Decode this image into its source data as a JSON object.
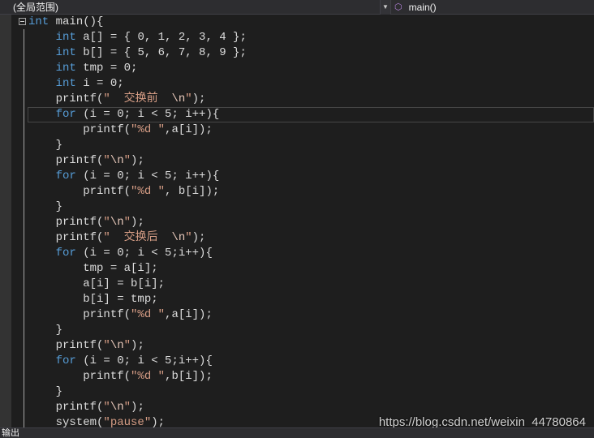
{
  "navigation_bar": {
    "scope_combo": "(全局范围)",
    "member_combo": "main()",
    "member_icon": "method-cube-icon"
  },
  "editor": {
    "lines": [
      [
        {
          "t": "int",
          "c": "kw"
        },
        {
          "t": " main(){",
          "c": "p"
        }
      ],
      [
        {
          "t": "    ",
          "c": "p"
        },
        {
          "t": "int",
          "c": "kw"
        },
        {
          "t": " a[] = { 0, 1, 2, 3, 4 };",
          "c": "p"
        }
      ],
      [
        {
          "t": "    ",
          "c": "p"
        },
        {
          "t": "int",
          "c": "kw"
        },
        {
          "t": " b[] = { 5, 6, 7, 8, 9 };",
          "c": "p"
        }
      ],
      [
        {
          "t": "    ",
          "c": "p"
        },
        {
          "t": "int",
          "c": "kw"
        },
        {
          "t": " tmp = 0;",
          "c": "p"
        }
      ],
      [
        {
          "t": "    ",
          "c": "p"
        },
        {
          "t": "int",
          "c": "kw"
        },
        {
          "t": " i = 0;",
          "c": "p"
        }
      ],
      [
        {
          "t": "    printf(",
          "c": "p"
        },
        {
          "t": "\"  交换前  ",
          "c": "str"
        },
        {
          "t": "\\n",
          "c": "esc"
        },
        {
          "t": "\"",
          "c": "str"
        },
        {
          "t": ");",
          "c": "p"
        }
      ],
      [
        {
          "t": "    ",
          "c": "p"
        },
        {
          "t": "for",
          "c": "kw"
        },
        {
          "t": " (i = 0; i < 5; i++){",
          "c": "p"
        }
      ],
      [
        {
          "t": "        printf(",
          "c": "p"
        },
        {
          "t": "\"%d \"",
          "c": "str"
        },
        {
          "t": ",a[i]);",
          "c": "p"
        }
      ],
      [
        {
          "t": "    }",
          "c": "p"
        }
      ],
      [
        {
          "t": "    printf(",
          "c": "p"
        },
        {
          "t": "\"",
          "c": "str"
        },
        {
          "t": "\\n",
          "c": "esc"
        },
        {
          "t": "\"",
          "c": "str"
        },
        {
          "t": ");",
          "c": "p"
        }
      ],
      [
        {
          "t": "    ",
          "c": "p"
        },
        {
          "t": "for",
          "c": "kw"
        },
        {
          "t": " (i = 0; i < 5; i++){",
          "c": "p"
        }
      ],
      [
        {
          "t": "        printf(",
          "c": "p"
        },
        {
          "t": "\"%d \"",
          "c": "str"
        },
        {
          "t": ", b[i]);",
          "c": "p"
        }
      ],
      [
        {
          "t": "    }",
          "c": "p"
        }
      ],
      [
        {
          "t": "    printf(",
          "c": "p"
        },
        {
          "t": "\"",
          "c": "str"
        },
        {
          "t": "\\n",
          "c": "esc"
        },
        {
          "t": "\"",
          "c": "str"
        },
        {
          "t": ");",
          "c": "p"
        }
      ],
      [
        {
          "t": "    printf(",
          "c": "p"
        },
        {
          "t": "\"  交换后  ",
          "c": "str"
        },
        {
          "t": "\\n",
          "c": "esc"
        },
        {
          "t": "\"",
          "c": "str"
        },
        {
          "t": ");",
          "c": "p"
        }
      ],
      [
        {
          "t": "    ",
          "c": "p"
        },
        {
          "t": "for",
          "c": "kw"
        },
        {
          "t": " (i = 0; i < 5;i++){",
          "c": "p"
        }
      ],
      [
        {
          "t": "        tmp = a[i];",
          "c": "p"
        }
      ],
      [
        {
          "t": "        a[i] = b[i];",
          "c": "p"
        }
      ],
      [
        {
          "t": "        b[i] = tmp;",
          "c": "p"
        }
      ],
      [
        {
          "t": "        printf(",
          "c": "p"
        },
        {
          "t": "\"%d \"",
          "c": "str"
        },
        {
          "t": ",a[i]);",
          "c": "p"
        }
      ],
      [
        {
          "t": "    }",
          "c": "p"
        }
      ],
      [
        {
          "t": "    printf(",
          "c": "p"
        },
        {
          "t": "\"",
          "c": "str"
        },
        {
          "t": "\\n",
          "c": "esc"
        },
        {
          "t": "\"",
          "c": "str"
        },
        {
          "t": ");",
          "c": "p"
        }
      ],
      [
        {
          "t": "    ",
          "c": "p"
        },
        {
          "t": "for",
          "c": "kw"
        },
        {
          "t": " (i = 0; i < 5;i++){",
          "c": "p"
        }
      ],
      [
        {
          "t": "        printf(",
          "c": "p"
        },
        {
          "t": "\"%d \"",
          "c": "str"
        },
        {
          "t": ",b[i]);",
          "c": "p"
        }
      ],
      [
        {
          "t": "    }",
          "c": "p"
        }
      ],
      [
        {
          "t": "    printf(",
          "c": "p"
        },
        {
          "t": "\"",
          "c": "str"
        },
        {
          "t": "\\n",
          "c": "esc"
        },
        {
          "t": "\"",
          "c": "str"
        },
        {
          "t": ");",
          "c": "p"
        }
      ],
      [
        {
          "t": "    system(",
          "c": "p"
        },
        {
          "t": "\"pause\"",
          "c": "str"
        },
        {
          "t": ");",
          "c": "p"
        }
      ]
    ]
  },
  "watermark": "https://blog.csdn.net/weixin_44780864",
  "output_panel": {
    "label": "输出"
  },
  "colors": {
    "background": "#1e1e1e",
    "keyword": "#569cd6",
    "string": "#d69d85",
    "plain": "#dcdcdc"
  }
}
